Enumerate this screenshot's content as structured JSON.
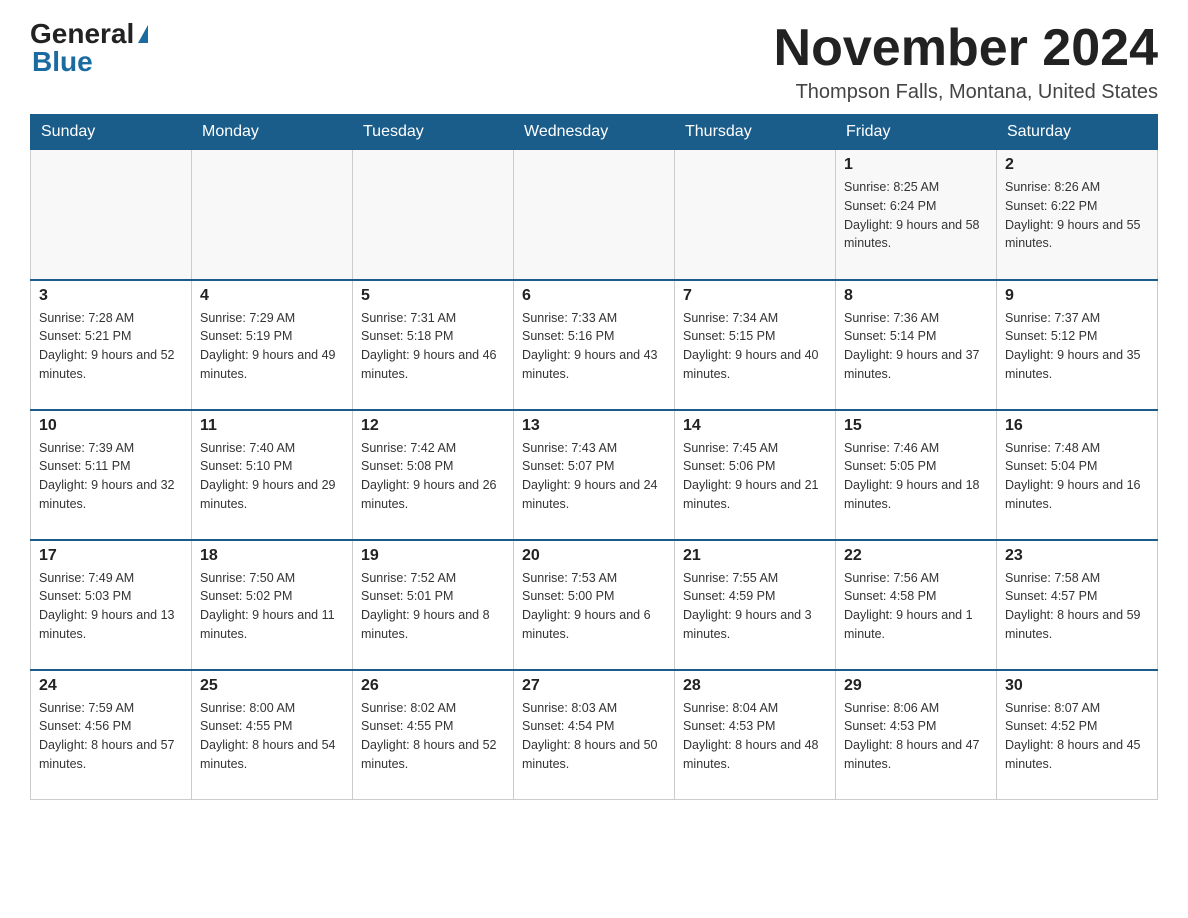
{
  "logo": {
    "general": "General",
    "blue": "Blue"
  },
  "title": {
    "month": "November 2024",
    "location": "Thompson Falls, Montana, United States"
  },
  "weekdays": [
    "Sunday",
    "Monday",
    "Tuesday",
    "Wednesday",
    "Thursday",
    "Friday",
    "Saturday"
  ],
  "weeks": [
    [
      {
        "day": "",
        "sunrise": "",
        "sunset": "",
        "daylight": ""
      },
      {
        "day": "",
        "sunrise": "",
        "sunset": "",
        "daylight": ""
      },
      {
        "day": "",
        "sunrise": "",
        "sunset": "",
        "daylight": ""
      },
      {
        "day": "",
        "sunrise": "",
        "sunset": "",
        "daylight": ""
      },
      {
        "day": "",
        "sunrise": "",
        "sunset": "",
        "daylight": ""
      },
      {
        "day": "1",
        "sunrise": "Sunrise: 8:25 AM",
        "sunset": "Sunset: 6:24 PM",
        "daylight": "Daylight: 9 hours and 58 minutes."
      },
      {
        "day": "2",
        "sunrise": "Sunrise: 8:26 AM",
        "sunset": "Sunset: 6:22 PM",
        "daylight": "Daylight: 9 hours and 55 minutes."
      }
    ],
    [
      {
        "day": "3",
        "sunrise": "Sunrise: 7:28 AM",
        "sunset": "Sunset: 5:21 PM",
        "daylight": "Daylight: 9 hours and 52 minutes."
      },
      {
        "day": "4",
        "sunrise": "Sunrise: 7:29 AM",
        "sunset": "Sunset: 5:19 PM",
        "daylight": "Daylight: 9 hours and 49 minutes."
      },
      {
        "day": "5",
        "sunrise": "Sunrise: 7:31 AM",
        "sunset": "Sunset: 5:18 PM",
        "daylight": "Daylight: 9 hours and 46 minutes."
      },
      {
        "day": "6",
        "sunrise": "Sunrise: 7:33 AM",
        "sunset": "Sunset: 5:16 PM",
        "daylight": "Daylight: 9 hours and 43 minutes."
      },
      {
        "day": "7",
        "sunrise": "Sunrise: 7:34 AM",
        "sunset": "Sunset: 5:15 PM",
        "daylight": "Daylight: 9 hours and 40 minutes."
      },
      {
        "day": "8",
        "sunrise": "Sunrise: 7:36 AM",
        "sunset": "Sunset: 5:14 PM",
        "daylight": "Daylight: 9 hours and 37 minutes."
      },
      {
        "day": "9",
        "sunrise": "Sunrise: 7:37 AM",
        "sunset": "Sunset: 5:12 PM",
        "daylight": "Daylight: 9 hours and 35 minutes."
      }
    ],
    [
      {
        "day": "10",
        "sunrise": "Sunrise: 7:39 AM",
        "sunset": "Sunset: 5:11 PM",
        "daylight": "Daylight: 9 hours and 32 minutes."
      },
      {
        "day": "11",
        "sunrise": "Sunrise: 7:40 AM",
        "sunset": "Sunset: 5:10 PM",
        "daylight": "Daylight: 9 hours and 29 minutes."
      },
      {
        "day": "12",
        "sunrise": "Sunrise: 7:42 AM",
        "sunset": "Sunset: 5:08 PM",
        "daylight": "Daylight: 9 hours and 26 minutes."
      },
      {
        "day": "13",
        "sunrise": "Sunrise: 7:43 AM",
        "sunset": "Sunset: 5:07 PM",
        "daylight": "Daylight: 9 hours and 24 minutes."
      },
      {
        "day": "14",
        "sunrise": "Sunrise: 7:45 AM",
        "sunset": "Sunset: 5:06 PM",
        "daylight": "Daylight: 9 hours and 21 minutes."
      },
      {
        "day": "15",
        "sunrise": "Sunrise: 7:46 AM",
        "sunset": "Sunset: 5:05 PM",
        "daylight": "Daylight: 9 hours and 18 minutes."
      },
      {
        "day": "16",
        "sunrise": "Sunrise: 7:48 AM",
        "sunset": "Sunset: 5:04 PM",
        "daylight": "Daylight: 9 hours and 16 minutes."
      }
    ],
    [
      {
        "day": "17",
        "sunrise": "Sunrise: 7:49 AM",
        "sunset": "Sunset: 5:03 PM",
        "daylight": "Daylight: 9 hours and 13 minutes."
      },
      {
        "day": "18",
        "sunrise": "Sunrise: 7:50 AM",
        "sunset": "Sunset: 5:02 PM",
        "daylight": "Daylight: 9 hours and 11 minutes."
      },
      {
        "day": "19",
        "sunrise": "Sunrise: 7:52 AM",
        "sunset": "Sunset: 5:01 PM",
        "daylight": "Daylight: 9 hours and 8 minutes."
      },
      {
        "day": "20",
        "sunrise": "Sunrise: 7:53 AM",
        "sunset": "Sunset: 5:00 PM",
        "daylight": "Daylight: 9 hours and 6 minutes."
      },
      {
        "day": "21",
        "sunrise": "Sunrise: 7:55 AM",
        "sunset": "Sunset: 4:59 PM",
        "daylight": "Daylight: 9 hours and 3 minutes."
      },
      {
        "day": "22",
        "sunrise": "Sunrise: 7:56 AM",
        "sunset": "Sunset: 4:58 PM",
        "daylight": "Daylight: 9 hours and 1 minute."
      },
      {
        "day": "23",
        "sunrise": "Sunrise: 7:58 AM",
        "sunset": "Sunset: 4:57 PM",
        "daylight": "Daylight: 8 hours and 59 minutes."
      }
    ],
    [
      {
        "day": "24",
        "sunrise": "Sunrise: 7:59 AM",
        "sunset": "Sunset: 4:56 PM",
        "daylight": "Daylight: 8 hours and 57 minutes."
      },
      {
        "day": "25",
        "sunrise": "Sunrise: 8:00 AM",
        "sunset": "Sunset: 4:55 PM",
        "daylight": "Daylight: 8 hours and 54 minutes."
      },
      {
        "day": "26",
        "sunrise": "Sunrise: 8:02 AM",
        "sunset": "Sunset: 4:55 PM",
        "daylight": "Daylight: 8 hours and 52 minutes."
      },
      {
        "day": "27",
        "sunrise": "Sunrise: 8:03 AM",
        "sunset": "Sunset: 4:54 PM",
        "daylight": "Daylight: 8 hours and 50 minutes."
      },
      {
        "day": "28",
        "sunrise": "Sunrise: 8:04 AM",
        "sunset": "Sunset: 4:53 PM",
        "daylight": "Daylight: 8 hours and 48 minutes."
      },
      {
        "day": "29",
        "sunrise": "Sunrise: 8:06 AM",
        "sunset": "Sunset: 4:53 PM",
        "daylight": "Daylight: 8 hours and 47 minutes."
      },
      {
        "day": "30",
        "sunrise": "Sunrise: 8:07 AM",
        "sunset": "Sunset: 4:52 PM",
        "daylight": "Daylight: 8 hours and 45 minutes."
      }
    ]
  ]
}
